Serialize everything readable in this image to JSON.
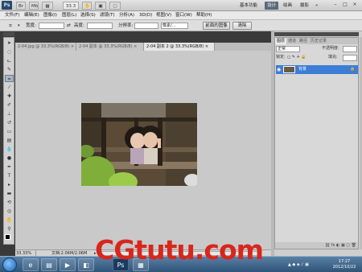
{
  "app": {
    "logo": "Ps",
    "toolbar_buttons": [
      "Br",
      "Mb"
    ],
    "zoom_value": "33.3",
    "workspaces": [
      "基本功能",
      "设计",
      "绘画",
      "摄影"
    ],
    "active_workspace": "设计",
    "more_label": "»"
  },
  "menu": [
    "文件(F)",
    "编辑(E)",
    "图像(I)",
    "图层(L)",
    "选择(S)",
    "滤镜(T)",
    "分析(A)",
    "3D(D)",
    "视图(V)",
    "窗口(W)",
    "帮助(H)"
  ],
  "options": {
    "width_label": "宽度:",
    "height_label": "高度:",
    "resolution_label": "分辨率:",
    "unit_value": "像素/...",
    "front_image_button": "前面的图像",
    "clear_button": "清除"
  },
  "doc_tabs": [
    {
      "label": "2-04.jpg @ 33.3%(RGB/8) ×"
    },
    {
      "label": "2-04 副本 @ 33.3%(RGB/8) ×"
    },
    {
      "label": "2-04 副本 2 @ 33.3%(RGB/8) ×",
      "active": true
    }
  ],
  "status": {
    "zoom": "33.33%",
    "doc_info": "文档:2.06M/2.06M"
  },
  "layers_panel": {
    "tabs": [
      "图层",
      "通道",
      "路径",
      "历史记录"
    ],
    "blend_mode": "正常",
    "opacity_label": "不透明度:",
    "lock_label": "锁定:",
    "fill_label": "填充:",
    "layer_name": "背景"
  },
  "taskbar": {
    "time": "17:27",
    "date": "2012/10/22"
  },
  "watermark": "CGtutu.com",
  "colors": {
    "accent": "#3d7dd6",
    "watermark": "#d9261c"
  }
}
